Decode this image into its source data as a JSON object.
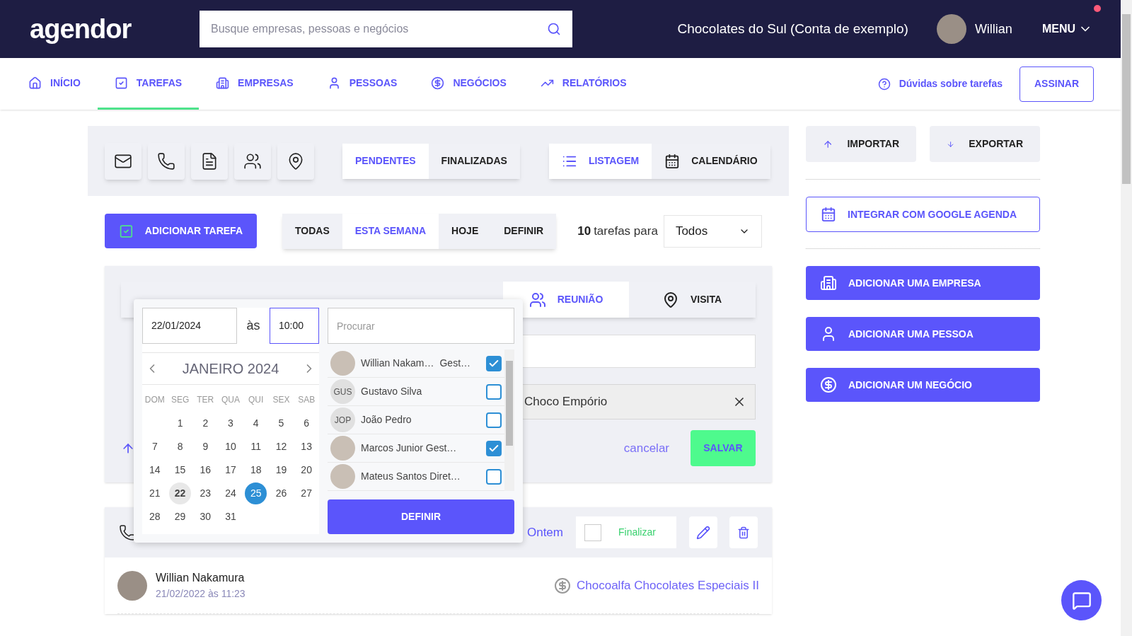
{
  "header": {
    "logo": "agendor",
    "search_placeholder": "Busque empresas, pessoas e negócios",
    "account": "Chocolates do Sul (Conta de exemplo)",
    "user": "Willian",
    "menu": "MENU",
    "menu_notification": true
  },
  "nav": {
    "items": [
      {
        "label": "INÍCIO",
        "selected": false
      },
      {
        "label": "TAREFAS",
        "selected": true
      },
      {
        "label": "EMPRESAS",
        "selected": false
      },
      {
        "label": "PESSOAS",
        "selected": false
      },
      {
        "label": "NEGÓCIOS",
        "selected": false
      },
      {
        "label": "RELATÓRIOS",
        "selected": false
      }
    ],
    "help": "Dúvidas sobre tarefas",
    "subscribe": "ASSINAR"
  },
  "toolbar": {
    "status_tabs": [
      {
        "label": "PENDENTES",
        "selected": true
      },
      {
        "label": "FINALIZADAS",
        "selected": false
      }
    ],
    "view_tabs": [
      {
        "label": "LISTAGEM",
        "selected": true
      },
      {
        "label": "CALENDÁRIO",
        "selected": false
      }
    ]
  },
  "filters": {
    "add_task": "ADICIONAR TAREFA",
    "periods": [
      {
        "label": "TODAS",
        "selected": false
      },
      {
        "label": "ESTA SEMANA",
        "selected": true
      },
      {
        "label": "HOJE",
        "selected": false
      },
      {
        "label": "DEFINIR",
        "selected": false
      }
    ],
    "count": "10",
    "count_label": "tarefas para",
    "owner": "Todos"
  },
  "task_form": {
    "types": [
      {
        "label": "REUNIÃO",
        "selected": true
      },
      {
        "label": "VISITA",
        "selected": false
      }
    ],
    "company": "Choco Empório",
    "cancel": "cancelar",
    "save": "SALVAR"
  },
  "popup": {
    "date": "22/01/2024",
    "at": "às",
    "time": "10:00",
    "month": "JANEIRO 2024",
    "weekdays": [
      "DOM",
      "SEG",
      "TER",
      "QUA",
      "QUI",
      "SEX",
      "SAB"
    ],
    "weeks": [
      [
        {
          "day": "1",
          "selected": false,
          "today": false
        },
        {
          "day": "2",
          "selected": false,
          "today": false
        },
        {
          "day": "3",
          "selected": false,
          "today": false
        },
        {
          "day": "4",
          "selected": false,
          "today": false
        },
        {
          "day": "5",
          "selected": false,
          "today": false
        },
        {
          "day": "6",
          "selected": false,
          "today": false
        }
      ],
      [
        {
          "day": "7",
          "selected": false,
          "today": false
        },
        {
          "day": "8",
          "selected": false,
          "today": false
        },
        {
          "day": "9",
          "selected": false,
          "today": false
        },
        {
          "day": "10",
          "selected": false,
          "today": false
        },
        {
          "day": "11",
          "selected": false,
          "today": false
        },
        {
          "day": "12",
          "selected": false,
          "today": false
        },
        {
          "day": "13",
          "selected": false,
          "today": false
        }
      ],
      [
        {
          "day": "14",
          "selected": false,
          "today": false
        },
        {
          "day": "15",
          "selected": false,
          "today": false
        },
        {
          "day": "16",
          "selected": false,
          "today": false
        },
        {
          "day": "17",
          "selected": false,
          "today": false
        },
        {
          "day": "18",
          "selected": false,
          "today": false
        },
        {
          "day": "19",
          "selected": false,
          "today": false
        },
        {
          "day": "20",
          "selected": false,
          "today": false
        }
      ],
      [
        {
          "day": "21",
          "selected": false,
          "today": false
        },
        {
          "day": "22",
          "selected": false,
          "today": true
        },
        {
          "day": "23",
          "selected": false,
          "today": false
        },
        {
          "day": "24",
          "selected": false,
          "today": false
        },
        {
          "day": "25",
          "selected": true,
          "today": false
        },
        {
          "day": "26",
          "selected": false,
          "today": false
        },
        {
          "day": "27",
          "selected": false,
          "today": false
        }
      ],
      [
        {
          "day": "28",
          "selected": false,
          "today": false
        },
        {
          "day": "29",
          "selected": false,
          "today": false
        },
        {
          "day": "30",
          "selected": false,
          "today": false
        },
        {
          "day": "31",
          "selected": false,
          "today": false
        }
      ]
    ],
    "search_placeholder": "Procurar",
    "people": [
      {
        "kind": "photo",
        "name": "Willian Nakam…",
        "role": "Gest…",
        "checked": true
      },
      {
        "kind": "initials",
        "initials": "GUS",
        "name": "Gustavo Silva",
        "checked": false
      },
      {
        "kind": "initials",
        "initials": "JOP",
        "name": "João Pedro",
        "checked": false
      },
      {
        "kind": "photo",
        "name": "Marcos Junior Gest…",
        "checked": true
      },
      {
        "kind": "photo",
        "name": "Mateus Santos Diret…",
        "checked": false
      }
    ],
    "confirm": "DEFINIR"
  },
  "task": {
    "due": "Ontem",
    "finish": "Finalizar",
    "finished": false,
    "author": "Willian Nakamura",
    "timestamp": "21/02/2022 às 11:23",
    "deal": "Chocoalfa Chocolates Especiais II"
  },
  "sidebar": {
    "import": "IMPORTAR",
    "export": "EXPORTAR",
    "google": "INTEGRAR COM GOOGLE AGENDA",
    "actions": [
      "ADICIONAR UMA EMPRESA",
      "ADICIONAR UMA PESSOA",
      "ADICIONAR UM NEGÓCIO"
    ]
  }
}
